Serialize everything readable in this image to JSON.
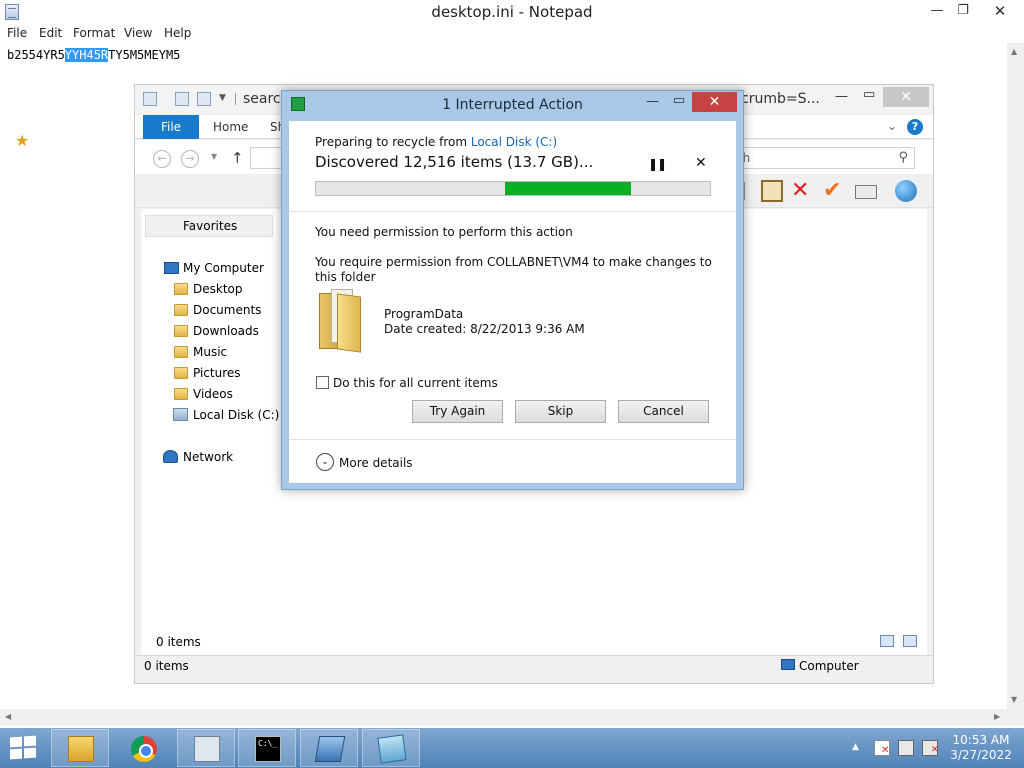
{
  "notepad": {
    "title": "desktop.ini - Notepad",
    "menu": [
      "File",
      "Edit",
      "Format",
      "View",
      "Help"
    ],
    "line_before": "b2554YR5",
    "line_selected": "YYH45R",
    "line_after": "TY5M5MEYM5"
  },
  "explorer": {
    "title_left": "search",
    "title_right": "crumb=S...",
    "tabs": {
      "file": "File",
      "home": "Home",
      "share": "Sh"
    },
    "search_placeholder": "ch",
    "favorites": "Favorites",
    "tree": {
      "my_computer": "My Computer",
      "desktop": "Desktop",
      "documents": "Documents",
      "downloads": "Downloads",
      "music": "Music",
      "pictures": "Pictures",
      "videos": "Videos",
      "local_disk": "Local Disk (C:)",
      "network": "Network"
    },
    "items_count": "0 items",
    "status_items": "0 items",
    "status_location": "Computer"
  },
  "dialog": {
    "title": "1 Interrupted Action",
    "preparing": "Preparing to recycle from ",
    "preparing_link": "Local Disk (C:)",
    "discovered": "Discovered 12,516 items (13.7 GB)...",
    "pause_glyph": "❚❚",
    "cancel_glyph": "✕",
    "progress": {
      "start_fraction": 0.48,
      "fill_fraction": 0.32
    },
    "permission_heading": "You need permission to perform this action",
    "permission_text": "You require permission from COLLABNET\\VM4 to make changes to this folder",
    "item_name": "ProgramData",
    "item_created": "Date created: 8/22/2013 9:36 AM",
    "checkbox_label": "Do this for all current items",
    "checkbox_checked": false,
    "buttons": {
      "try_again": "Try Again",
      "skip": "Skip",
      "cancel": "Cancel"
    },
    "more_details": "More details"
  },
  "taskbar": {
    "time": "10:53 AM",
    "date": "3/27/2022",
    "cmd_text": "C:\\_"
  },
  "colors": {
    "progress_green": "#06b025",
    "file_tab_blue": "#1979ca",
    "link_blue": "#1766b4",
    "dialog_close_red": "#c74343"
  }
}
